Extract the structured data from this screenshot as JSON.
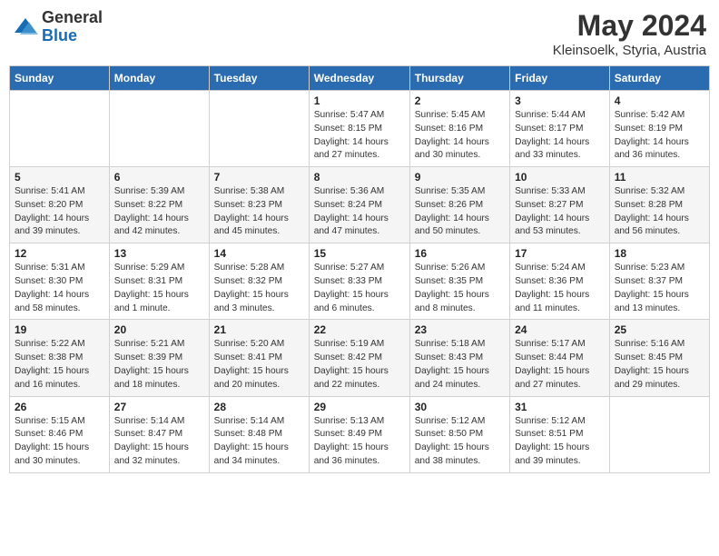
{
  "header": {
    "logo_general": "General",
    "logo_blue": "Blue",
    "title": "May 2024",
    "location": "Kleinsoelk, Styria, Austria"
  },
  "weekdays": [
    "Sunday",
    "Monday",
    "Tuesday",
    "Wednesday",
    "Thursday",
    "Friday",
    "Saturday"
  ],
  "weeks": [
    [
      {
        "day": "",
        "sunrise": "",
        "sunset": "",
        "daylight": ""
      },
      {
        "day": "",
        "sunrise": "",
        "sunset": "",
        "daylight": ""
      },
      {
        "day": "",
        "sunrise": "",
        "sunset": "",
        "daylight": ""
      },
      {
        "day": "1",
        "sunrise": "Sunrise: 5:47 AM",
        "sunset": "Sunset: 8:15 PM",
        "daylight": "Daylight: 14 hours and 27 minutes."
      },
      {
        "day": "2",
        "sunrise": "Sunrise: 5:45 AM",
        "sunset": "Sunset: 8:16 PM",
        "daylight": "Daylight: 14 hours and 30 minutes."
      },
      {
        "day": "3",
        "sunrise": "Sunrise: 5:44 AM",
        "sunset": "Sunset: 8:17 PM",
        "daylight": "Daylight: 14 hours and 33 minutes."
      },
      {
        "day": "4",
        "sunrise": "Sunrise: 5:42 AM",
        "sunset": "Sunset: 8:19 PM",
        "daylight": "Daylight: 14 hours and 36 minutes."
      }
    ],
    [
      {
        "day": "5",
        "sunrise": "Sunrise: 5:41 AM",
        "sunset": "Sunset: 8:20 PM",
        "daylight": "Daylight: 14 hours and 39 minutes."
      },
      {
        "day": "6",
        "sunrise": "Sunrise: 5:39 AM",
        "sunset": "Sunset: 8:22 PM",
        "daylight": "Daylight: 14 hours and 42 minutes."
      },
      {
        "day": "7",
        "sunrise": "Sunrise: 5:38 AM",
        "sunset": "Sunset: 8:23 PM",
        "daylight": "Daylight: 14 hours and 45 minutes."
      },
      {
        "day": "8",
        "sunrise": "Sunrise: 5:36 AM",
        "sunset": "Sunset: 8:24 PM",
        "daylight": "Daylight: 14 hours and 47 minutes."
      },
      {
        "day": "9",
        "sunrise": "Sunrise: 5:35 AM",
        "sunset": "Sunset: 8:26 PM",
        "daylight": "Daylight: 14 hours and 50 minutes."
      },
      {
        "day": "10",
        "sunrise": "Sunrise: 5:33 AM",
        "sunset": "Sunset: 8:27 PM",
        "daylight": "Daylight: 14 hours and 53 minutes."
      },
      {
        "day": "11",
        "sunrise": "Sunrise: 5:32 AM",
        "sunset": "Sunset: 8:28 PM",
        "daylight": "Daylight: 14 hours and 56 minutes."
      }
    ],
    [
      {
        "day": "12",
        "sunrise": "Sunrise: 5:31 AM",
        "sunset": "Sunset: 8:30 PM",
        "daylight": "Daylight: 14 hours and 58 minutes."
      },
      {
        "day": "13",
        "sunrise": "Sunrise: 5:29 AM",
        "sunset": "Sunset: 8:31 PM",
        "daylight": "Daylight: 15 hours and 1 minute."
      },
      {
        "day": "14",
        "sunrise": "Sunrise: 5:28 AM",
        "sunset": "Sunset: 8:32 PM",
        "daylight": "Daylight: 15 hours and 3 minutes."
      },
      {
        "day": "15",
        "sunrise": "Sunrise: 5:27 AM",
        "sunset": "Sunset: 8:33 PM",
        "daylight": "Daylight: 15 hours and 6 minutes."
      },
      {
        "day": "16",
        "sunrise": "Sunrise: 5:26 AM",
        "sunset": "Sunset: 8:35 PM",
        "daylight": "Daylight: 15 hours and 8 minutes."
      },
      {
        "day": "17",
        "sunrise": "Sunrise: 5:24 AM",
        "sunset": "Sunset: 8:36 PM",
        "daylight": "Daylight: 15 hours and 11 minutes."
      },
      {
        "day": "18",
        "sunrise": "Sunrise: 5:23 AM",
        "sunset": "Sunset: 8:37 PM",
        "daylight": "Daylight: 15 hours and 13 minutes."
      }
    ],
    [
      {
        "day": "19",
        "sunrise": "Sunrise: 5:22 AM",
        "sunset": "Sunset: 8:38 PM",
        "daylight": "Daylight: 15 hours and 16 minutes."
      },
      {
        "day": "20",
        "sunrise": "Sunrise: 5:21 AM",
        "sunset": "Sunset: 8:39 PM",
        "daylight": "Daylight: 15 hours and 18 minutes."
      },
      {
        "day": "21",
        "sunrise": "Sunrise: 5:20 AM",
        "sunset": "Sunset: 8:41 PM",
        "daylight": "Daylight: 15 hours and 20 minutes."
      },
      {
        "day": "22",
        "sunrise": "Sunrise: 5:19 AM",
        "sunset": "Sunset: 8:42 PM",
        "daylight": "Daylight: 15 hours and 22 minutes."
      },
      {
        "day": "23",
        "sunrise": "Sunrise: 5:18 AM",
        "sunset": "Sunset: 8:43 PM",
        "daylight": "Daylight: 15 hours and 24 minutes."
      },
      {
        "day": "24",
        "sunrise": "Sunrise: 5:17 AM",
        "sunset": "Sunset: 8:44 PM",
        "daylight": "Daylight: 15 hours and 27 minutes."
      },
      {
        "day": "25",
        "sunrise": "Sunrise: 5:16 AM",
        "sunset": "Sunset: 8:45 PM",
        "daylight": "Daylight: 15 hours and 29 minutes."
      }
    ],
    [
      {
        "day": "26",
        "sunrise": "Sunrise: 5:15 AM",
        "sunset": "Sunset: 8:46 PM",
        "daylight": "Daylight: 15 hours and 30 minutes."
      },
      {
        "day": "27",
        "sunrise": "Sunrise: 5:14 AM",
        "sunset": "Sunset: 8:47 PM",
        "daylight": "Daylight: 15 hours and 32 minutes."
      },
      {
        "day": "28",
        "sunrise": "Sunrise: 5:14 AM",
        "sunset": "Sunset: 8:48 PM",
        "daylight": "Daylight: 15 hours and 34 minutes."
      },
      {
        "day": "29",
        "sunrise": "Sunrise: 5:13 AM",
        "sunset": "Sunset: 8:49 PM",
        "daylight": "Daylight: 15 hours and 36 minutes."
      },
      {
        "day": "30",
        "sunrise": "Sunrise: 5:12 AM",
        "sunset": "Sunset: 8:50 PM",
        "daylight": "Daylight: 15 hours and 38 minutes."
      },
      {
        "day": "31",
        "sunrise": "Sunrise: 5:12 AM",
        "sunset": "Sunset: 8:51 PM",
        "daylight": "Daylight: 15 hours and 39 minutes."
      },
      {
        "day": "",
        "sunrise": "",
        "sunset": "",
        "daylight": ""
      }
    ]
  ]
}
